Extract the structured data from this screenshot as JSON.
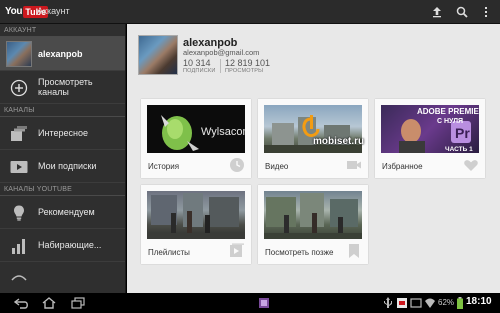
{
  "actionbar": {
    "logo_you": "You",
    "logo_tube": "Tube",
    "title": "Аккаунт"
  },
  "sidebar": {
    "section_account": "АККАУНТ",
    "account_name": "alexanpob",
    "browse_channels": "Просмотреть каналы",
    "section_channels": "КАНАЛЫ",
    "interesting": "Интересное",
    "my_subscriptions": "Мои подписки",
    "section_youtube": "КАНАЛЫ YOUTUBE",
    "recommended": "Рекомендуем",
    "trending": "Набирающие..."
  },
  "profile": {
    "name": "alexanpob",
    "email": "alexanpob@gmail.com",
    "subscribers_value": "10 314",
    "subscribers_caption": "ПОДПИСКИ",
    "views_value": "12 819 101",
    "views_caption": "ПРОСМОТРЫ"
  },
  "tiles": {
    "history": "История",
    "video": "Видео",
    "favorites": "Избранное",
    "playlists": "Плейлисты",
    "watch_later": "Посмотреть позже"
  },
  "thumb_texts": {
    "history": "Wylsacom",
    "favorites_title": "ADOBE PREMIERE",
    "favorites_sub": "С НУЛЯ",
    "favorites_part": "ЧАСТЬ 1"
  },
  "watermark": "mobiset.ru",
  "system": {
    "battery": "62%",
    "clock": "18:10"
  },
  "colors": {
    "brand_red": "#cc181e",
    "sidebar_bg": "#2f2f2f",
    "content_bg": "#e8e8e8"
  }
}
